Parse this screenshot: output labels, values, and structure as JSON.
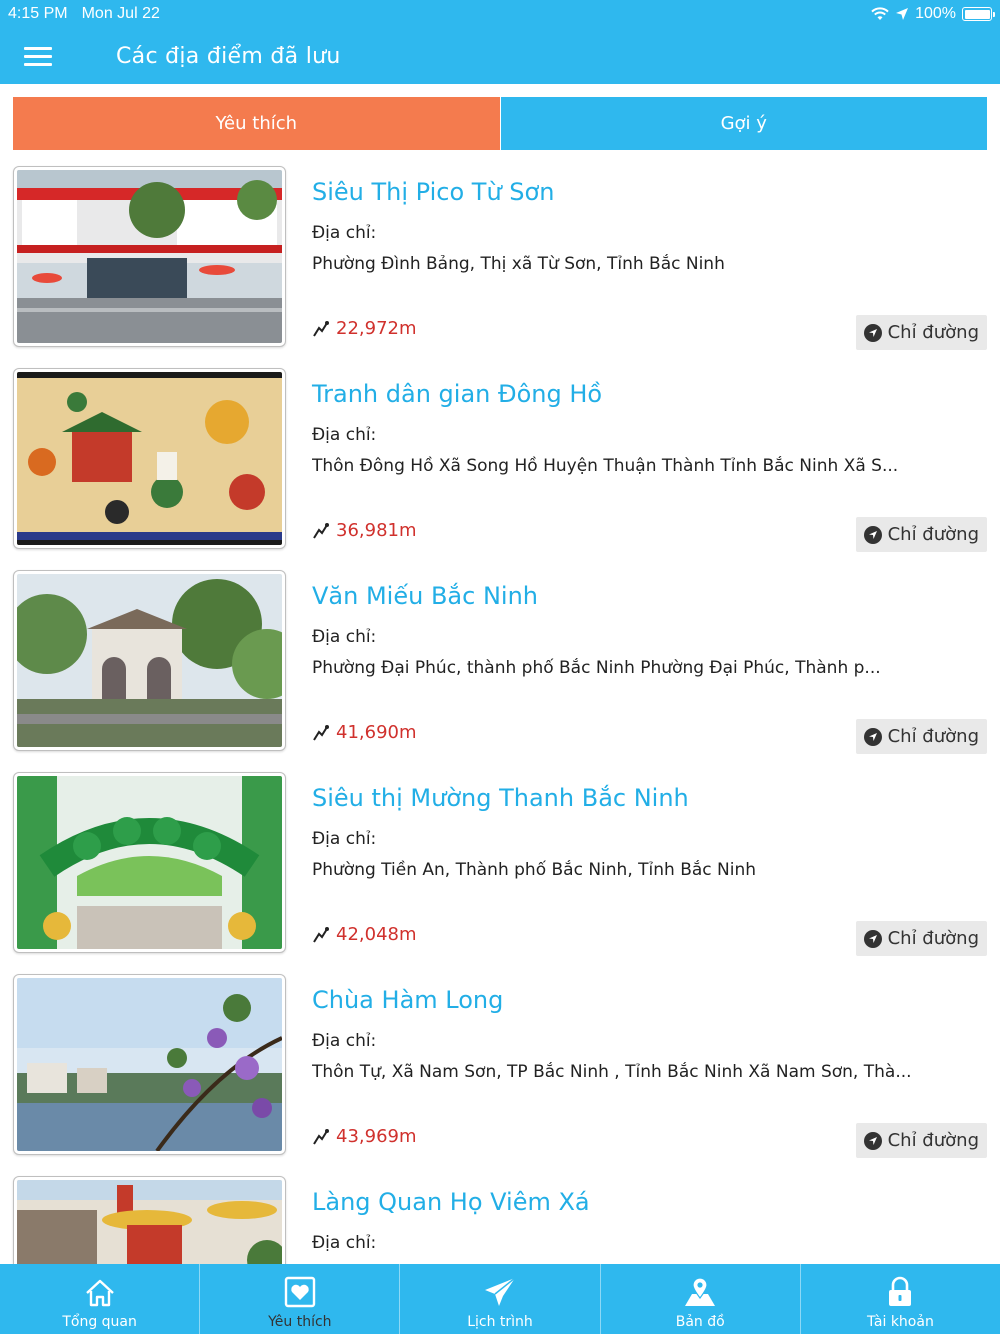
{
  "status_bar": {
    "time": "4:15 PM",
    "date": "Mon Jul 22",
    "battery": "100%"
  },
  "nav": {
    "title": "Các địa điểm đã lưu"
  },
  "tabs": [
    {
      "label": "Yêu thích",
      "active": true
    },
    {
      "label": "Gợi ý",
      "active": false
    }
  ],
  "address_label": "Địa chỉ:",
  "route_label": "Chỉ đường",
  "places": [
    {
      "name": "Siêu Thị Pico Từ Sơn",
      "address": "Phường Đình Bảng, Thị xã Từ Sơn, Tỉnh Bắc Ninh",
      "distance": "22,972m"
    },
    {
      "name": "Tranh dân gian Đông Hồ",
      "address": "Thôn Đông Hồ Xã Song Hồ Huyện Thuận Thành Tỉnh Bắc Ninh Xã S...",
      "distance": "36,981m"
    },
    {
      "name": "Văn Miếu Bắc Ninh",
      "address": "Phường Đại Phúc, thành phố Bắc Ninh Phường Đại Phúc, Thành p...",
      "distance": "41,690m"
    },
    {
      "name": "Siêu thị Mường Thanh Bắc Ninh",
      "address": "Phường Tiền An, Thành phố Bắc Ninh, Tỉnh Bắc Ninh",
      "distance": "42,048m"
    },
    {
      "name": "Chùa Hàm Long",
      "address": "Thôn Tự, Xã Nam Sơn, TP Bắc Ninh , Tỉnh Bắc Ninh Xã Nam Sơn, Thà...",
      "distance": "43,969m"
    },
    {
      "name": "Làng Quan Họ Viêm Xá",
      "address": "",
      "distance": ""
    }
  ],
  "tabbar": [
    {
      "label": "Tổng quan",
      "icon": "home-icon",
      "active": false
    },
    {
      "label": "Yêu thích",
      "icon": "heart-icon",
      "active": true
    },
    {
      "label": "Lịch trình",
      "icon": "paper-plane-icon",
      "active": false
    },
    {
      "label": "Bản đồ",
      "icon": "map-pin-icon",
      "active": false
    },
    {
      "label": "Tài khoản",
      "icon": "lock-icon",
      "active": false
    }
  ],
  "colors": {
    "primary": "#2fb8ee",
    "active_tab": "#f47b4e",
    "title_text": "#22aee6",
    "distance_text": "#d0312d",
    "route_button_bg": "#e9e9e9"
  }
}
